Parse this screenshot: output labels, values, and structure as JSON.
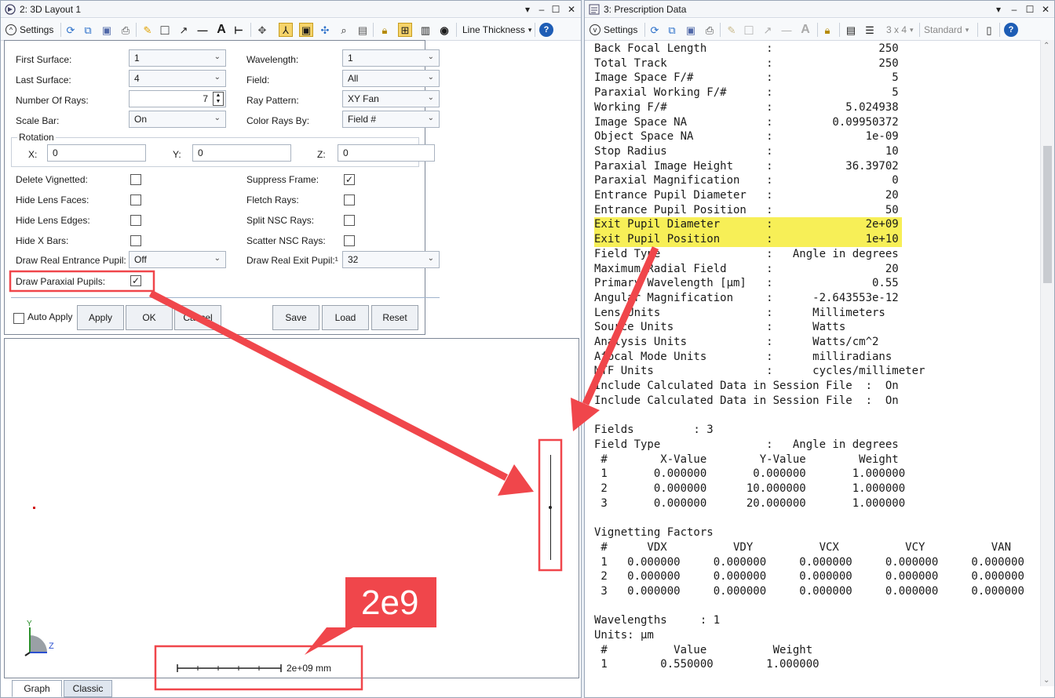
{
  "left_window": {
    "title": "2: 3D Layout 1",
    "settings_label": "Settings",
    "line_thickness_label": "Line Thickness",
    "form": {
      "first_surface": {
        "label": "First Surface:",
        "value": "1"
      },
      "last_surface": {
        "label": "Last Surface:",
        "value": "4"
      },
      "number_of_rays": {
        "label": "Number Of Rays:",
        "value": "7"
      },
      "scale_bar": {
        "label": "Scale Bar:",
        "value": "On"
      },
      "wavelength": {
        "label": "Wavelength:",
        "value": "1"
      },
      "field": {
        "label": "Field:",
        "value": "All"
      },
      "ray_pattern": {
        "label": "Ray Pattern:",
        "value": "XY Fan"
      },
      "color_rays_by": {
        "label": "Color Rays By:",
        "value": "Field #"
      },
      "rotation_title": "Rotation",
      "rot_x": {
        "label": "X:",
        "value": "0"
      },
      "rot_y": {
        "label": "Y:",
        "value": "0"
      },
      "rot_z": {
        "label": "Z:",
        "value": "0"
      },
      "delete_vignetted": {
        "label": "Delete Vignetted:",
        "checked": false
      },
      "hide_lens_faces": {
        "label": "Hide Lens Faces:",
        "checked": false
      },
      "hide_lens_edges": {
        "label": "Hide Lens Edges:",
        "checked": false
      },
      "hide_x_bars": {
        "label": "Hide X Bars:",
        "checked": false
      },
      "suppress_frame": {
        "label": "Suppress Frame:",
        "checked": true
      },
      "fletch_rays": {
        "label": "Fletch Rays:",
        "checked": false
      },
      "split_nsc_rays": {
        "label": "Split NSC Rays:",
        "checked": false
      },
      "scatter_nsc_rays": {
        "label": "Scatter NSC Rays:",
        "checked": false
      },
      "draw_real_entrance_pupil": {
        "label": "Draw Real Entrance Pupil:",
        "value": "Off"
      },
      "draw_real_exit_pupil": {
        "label": "Draw Real Exit Pupil:¹",
        "value": "32"
      },
      "draw_paraxial_pupils": {
        "label": "Draw Paraxial Pupils:",
        "checked": true
      },
      "auto_apply": {
        "label": "Auto Apply",
        "checked": false
      },
      "buttons": {
        "apply": "Apply",
        "ok": "OK",
        "cancel": "Cancel",
        "save": "Save",
        "load": "Load",
        "reset": "Reset"
      }
    },
    "scale_bar_text": "2e+09 mm",
    "axis": {
      "y": "Y",
      "z": "Z"
    },
    "tabs": [
      "Graph",
      "Classic"
    ]
  },
  "callout_text": "2e9",
  "right_window": {
    "title": "3: Prescription Data",
    "settings_label": "Settings",
    "grid_label": "3 x 4",
    "standard_label": "Standard",
    "lines": [
      {
        "text": "Back Focal Length         :                250",
        "highlight": false
      },
      {
        "text": "Total Track               :                250",
        "highlight": false
      },
      {
        "text": "Image Space F/#           :                  5",
        "highlight": false
      },
      {
        "text": "Paraxial Working F/#      :                  5",
        "highlight": false
      },
      {
        "text": "Working F/#               :           5.024938",
        "highlight": false
      },
      {
        "text": "Image Space NA            :         0.09950372",
        "highlight": false
      },
      {
        "text": "Object Space NA           :              1e-09",
        "highlight": false
      },
      {
        "text": "Stop Radius               :                 10",
        "highlight": false
      },
      {
        "text": "Paraxial Image Height     :           36.39702",
        "highlight": false
      },
      {
        "text": "Paraxial Magnification    :                  0",
        "highlight": false
      },
      {
        "text": "Entrance Pupil Diameter   :                 20",
        "highlight": false
      },
      {
        "text": "Entrance Pupil Position   :                 50",
        "highlight": false
      },
      {
        "text": "Exit Pupil Diameter       :              2e+09",
        "highlight": true
      },
      {
        "text": "Exit Pupil Position       :              1e+10",
        "highlight": true
      },
      {
        "text": "Field Type                :   Angle in degrees",
        "highlight": false
      },
      {
        "text": "Maximum Radial Field      :                 20",
        "highlight": false
      },
      {
        "text": "Primary Wavelength [µm]   :               0.55",
        "highlight": false
      },
      {
        "text": "Angular Magnification     :      -2.643553e-12",
        "highlight": false
      },
      {
        "text": "Lens Units                :      Millimeters",
        "highlight": false
      },
      {
        "text": "Source Units              :      Watts",
        "highlight": false
      },
      {
        "text": "Analysis Units            :      Watts/cm^2",
        "highlight": false
      },
      {
        "text": "Afocal Mode Units         :      milliradians",
        "highlight": false
      },
      {
        "text": "MTF Units                 :      cycles/millimeter",
        "highlight": false
      },
      {
        "text": "Include Calculated Data in Session File  :  On",
        "highlight": false
      },
      {
        "text": "Include Calculated Data in Session File  :  On",
        "highlight": false
      },
      {
        "text": "",
        "highlight": false
      },
      {
        "text": "Fields         : 3",
        "highlight": false
      },
      {
        "text": "Field Type                :   Angle in degrees",
        "highlight": false
      },
      {
        "text": " #        X-Value        Y-Value        Weight",
        "highlight": false
      },
      {
        "text": " 1       0.000000       0.000000       1.000000",
        "highlight": false
      },
      {
        "text": " 2       0.000000      10.000000       1.000000",
        "highlight": false
      },
      {
        "text": " 3       0.000000      20.000000       1.000000",
        "highlight": false
      },
      {
        "text": "",
        "highlight": false
      },
      {
        "text": "Vignetting Factors",
        "highlight": false
      },
      {
        "text": " #      VDX          VDY          VCX          VCY          VAN",
        "highlight": false
      },
      {
        "text": " 1   0.000000     0.000000     0.000000     0.000000     0.000000",
        "highlight": false
      },
      {
        "text": " 2   0.000000     0.000000     0.000000     0.000000     0.000000",
        "highlight": false
      },
      {
        "text": " 3   0.000000     0.000000     0.000000     0.000000     0.000000",
        "highlight": false
      },
      {
        "text": "",
        "highlight": false
      },
      {
        "text": "Wavelengths     : 1",
        "highlight": false
      },
      {
        "text": "Units: µm",
        "highlight": false
      },
      {
        "text": " #          Value          Weight",
        "highlight": false
      },
      {
        "text": " 1        0.550000        1.000000",
        "highlight": false
      }
    ]
  },
  "colors": {
    "annotation_red": "#f0464b",
    "highlight_yellow": "#f7ef57"
  }
}
